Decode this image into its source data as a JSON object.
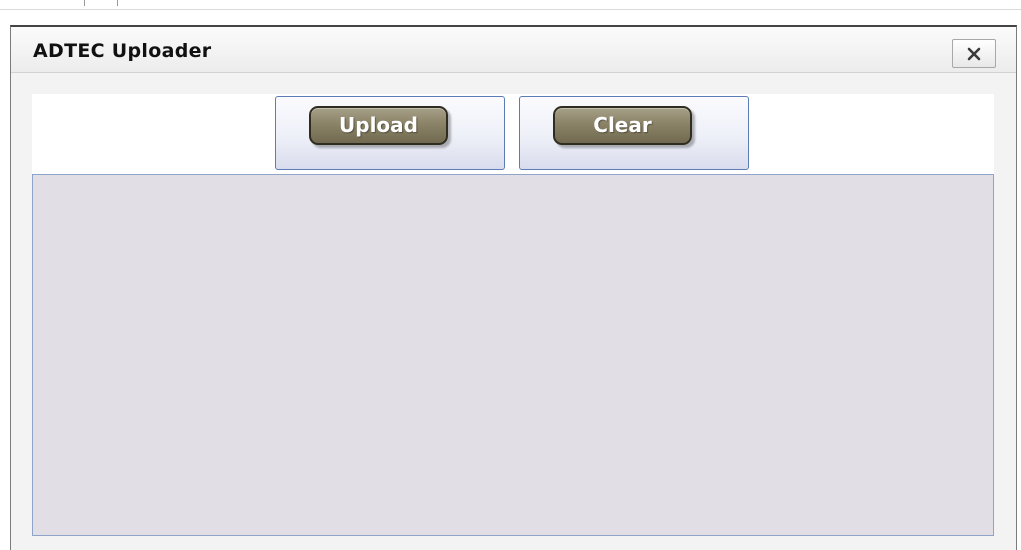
{
  "window": {
    "title": "ADTEC Uploader"
  },
  "toolbar": {
    "upload_label": "Upload",
    "clear_label": "Clear"
  },
  "icons": {
    "close": "close-icon"
  },
  "colors": {
    "button_pill": "#8a8367",
    "button_border": "#5b7cb5",
    "drop_area_bg": "#e1dfe5",
    "drop_area_border": "#8ea4c8"
  }
}
